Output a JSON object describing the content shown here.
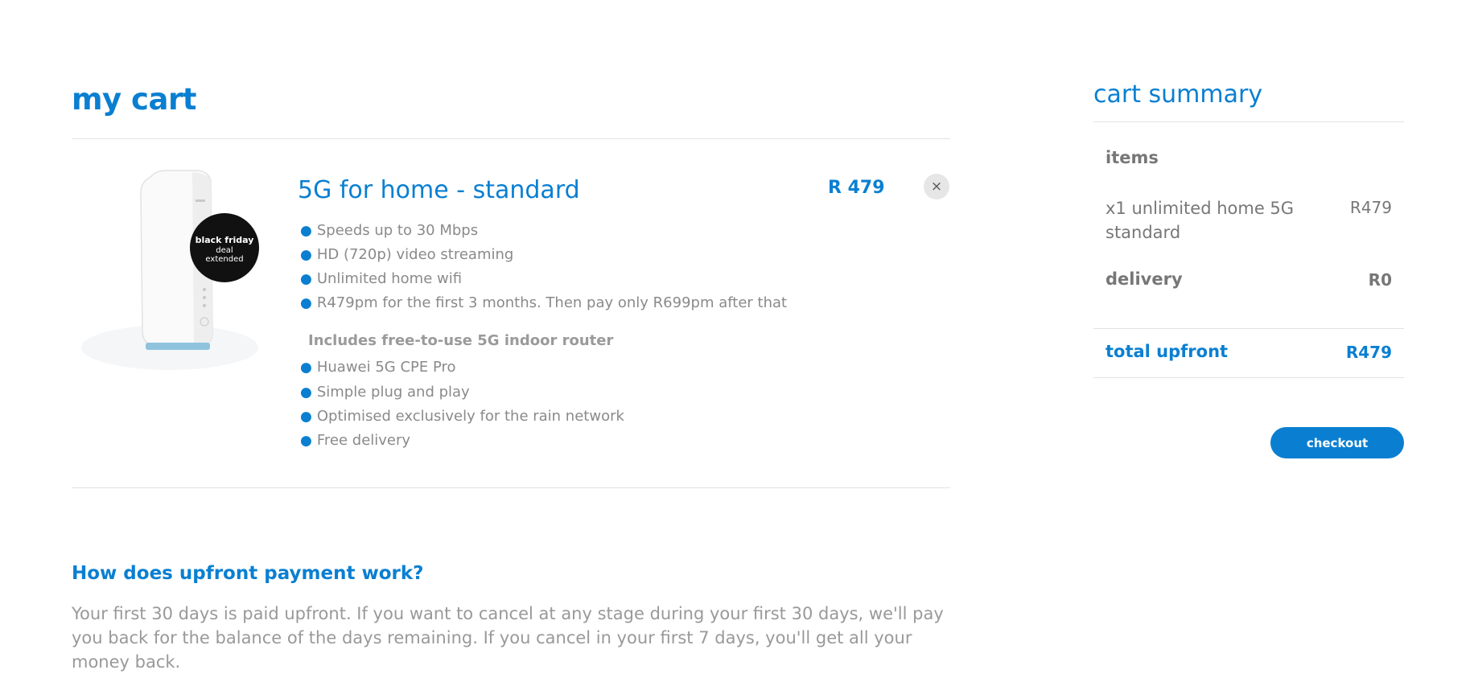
{
  "cart": {
    "title": "my cart",
    "product": {
      "name": "5G for home - standard",
      "price": "R 479",
      "remove_label": "×",
      "badge": [
        "black friday",
        "deal",
        "extended"
      ],
      "features": [
        "Speeds up to 30 Mbps",
        "HD (720p) video streaming",
        "Unlimited home wifi",
        "R479pm for the first 3 months. Then pay only R699pm after that"
      ],
      "includes_heading": "Includes free-to-use 5G indoor router",
      "router_features": [
        "Huawei 5G CPE Pro",
        "Simple plug and play",
        "Optimised exclusively for the rain network",
        "Free delivery"
      ]
    },
    "faq": {
      "question": "How does upfront payment work?",
      "answer": "Your first 30 days is paid upfront. If you want to cancel at any stage during your first 30 days, we'll pay you back for the balance of the days remaining. If you cancel in your first 7 days, you'll get all your money back."
    }
  },
  "summary": {
    "title": "cart summary",
    "items_label": "items",
    "line_item_label": "x1 unlimited home 5G standard",
    "line_item_value": "R479",
    "delivery_label": "delivery",
    "delivery_value": "R0",
    "total_label": "total upfront",
    "total_value": "R479",
    "checkout_label": "checkout"
  },
  "colors": {
    "accent": "#0a7fd1",
    "text": "#8a8a8a",
    "divider": "#e3e3e3",
    "badge": "#111111"
  },
  "icons": {
    "remove": "close-icon",
    "bullet": "bullet-icon"
  }
}
